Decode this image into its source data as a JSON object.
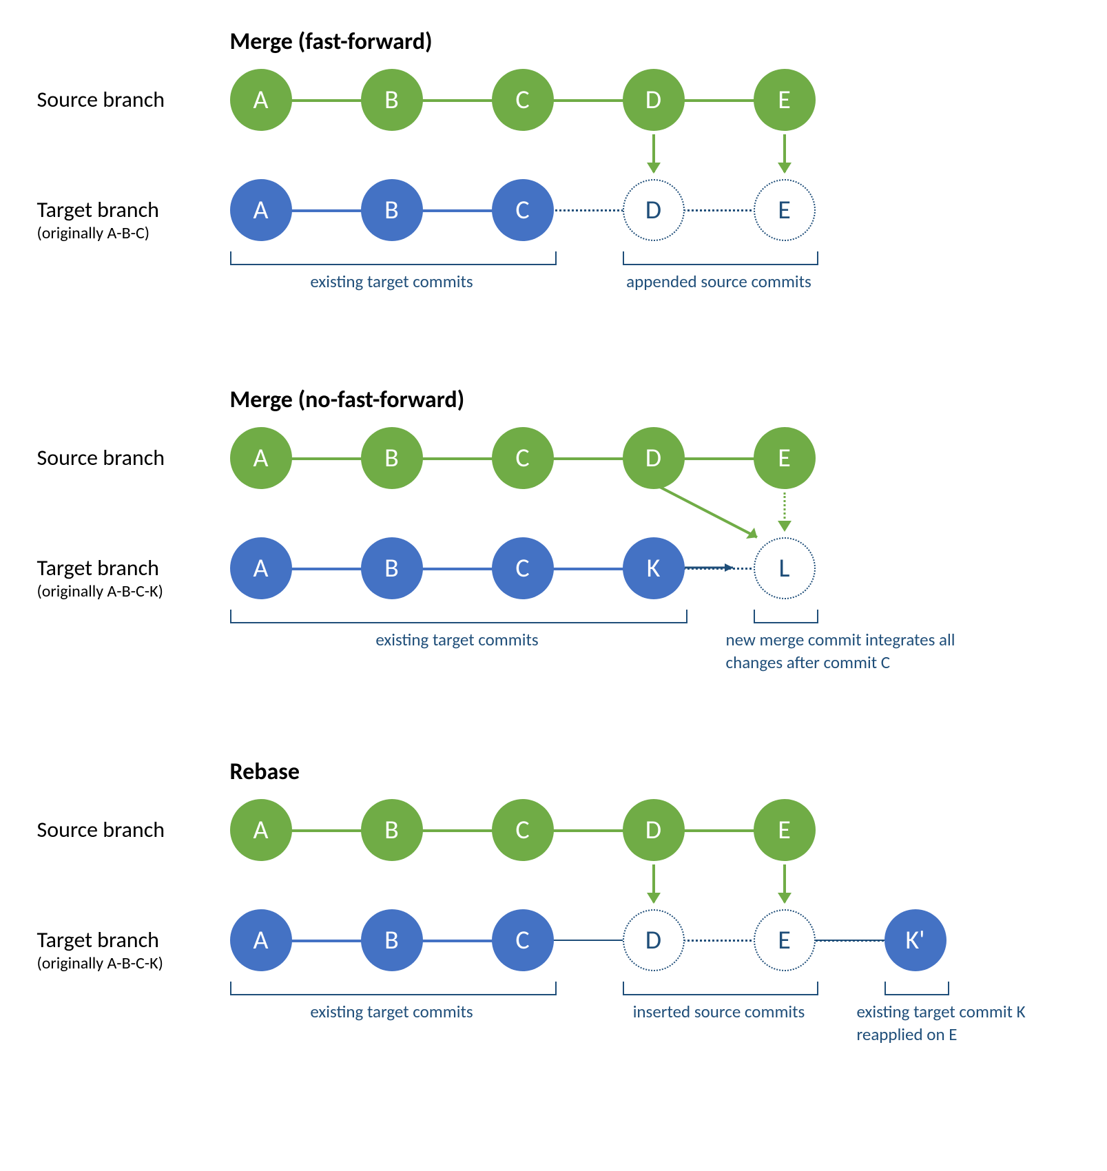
{
  "colors": {
    "green": "#70AC46",
    "blue": "#4472C4",
    "darkblue": "#1F4E79"
  },
  "diagrams": [
    {
      "id": "ff",
      "title": "Merge (fast-forward)",
      "source_label": "Source branch",
      "target_label": "Target branch",
      "target_sub": "(originally A-B-C)",
      "source_nodes": [
        "A",
        "B",
        "C",
        "D",
        "E"
      ],
      "target_nodes_solid": [
        "A",
        "B",
        "C"
      ],
      "target_nodes_dashed": [
        "D",
        "E"
      ],
      "brackets": [
        {
          "label": "existing target commits"
        },
        {
          "label": "appended source commits"
        }
      ]
    },
    {
      "id": "noff",
      "title": "Merge (no-fast-forward)",
      "source_label": "Source branch",
      "target_label": "Target branch",
      "target_sub": "(originally A-B-C-K)",
      "source_nodes": [
        "A",
        "B",
        "C",
        "D",
        "E"
      ],
      "target_nodes_solid": [
        "A",
        "B",
        "C",
        "K"
      ],
      "target_nodes_dashed": [
        "L"
      ],
      "brackets": [
        {
          "label": "existing target commits"
        },
        {
          "label": "new merge commit integrates all changes after commit C"
        }
      ]
    },
    {
      "id": "rebase",
      "title": "Rebase",
      "source_label": "Source branch",
      "target_label": "Target branch",
      "target_sub": "(originally A-B-C-K)",
      "source_nodes": [
        "A",
        "B",
        "C",
        "D",
        "E"
      ],
      "target_nodes_solid": [
        "A",
        "B",
        "C"
      ],
      "target_nodes_dashed": [
        "D",
        "E"
      ],
      "target_nodes_solid_after": [
        "K'"
      ],
      "brackets": [
        {
          "label": "existing target commits"
        },
        {
          "label": "inserted source commits"
        },
        {
          "label": "existing target commit K reapplied on E"
        }
      ]
    }
  ]
}
